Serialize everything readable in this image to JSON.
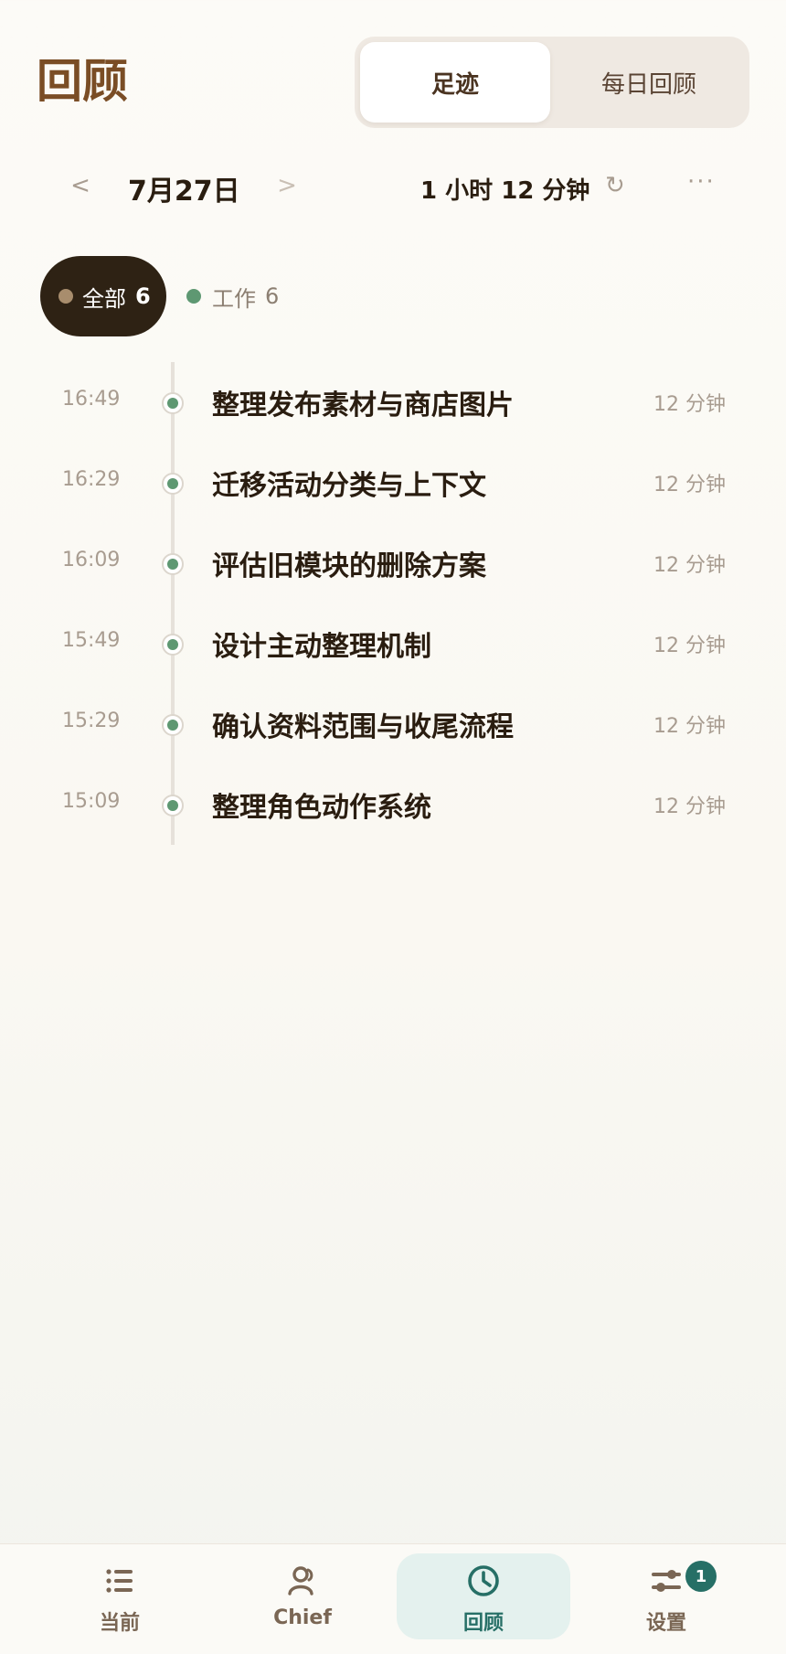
{
  "header": {
    "title": "回顾",
    "segments": [
      {
        "label": "足迹",
        "active": true
      },
      {
        "label": "每日回顾",
        "active": false
      }
    ]
  },
  "date_bar": {
    "prev_label": "<",
    "date": "7月27日",
    "next_label": ">",
    "total_duration": "1 小时 12 分钟",
    "refresh_label": "↻",
    "more_label": "···"
  },
  "filters": {
    "all": {
      "label": "全部",
      "count": "6"
    },
    "work": {
      "label": "工作",
      "count": "6"
    }
  },
  "timeline": [
    {
      "time": "16:49",
      "title": "整理发布素材与商店图片",
      "duration": "12 分钟"
    },
    {
      "time": "16:29",
      "title": "迁移活动分类与上下文",
      "duration": "12 分钟"
    },
    {
      "time": "16:09",
      "title": "评估旧模块的删除方案",
      "duration": "12 分钟"
    },
    {
      "time": "15:49",
      "title": "设计主动整理机制",
      "duration": "12 分钟"
    },
    {
      "time": "15:29",
      "title": "确认资料范围与收尾流程",
      "duration": "12 分钟"
    },
    {
      "time": "15:09",
      "title": "整理角色动作系统",
      "duration": "12 分钟"
    }
  ],
  "bottom_nav": [
    {
      "label": "当前",
      "icon": "list-icon",
      "active": false
    },
    {
      "label": "Chief",
      "icon": "person-icon",
      "active": false
    },
    {
      "label": "回顾",
      "icon": "clock-icon",
      "active": true
    },
    {
      "label": "设置",
      "icon": "sliders-icon",
      "active": false,
      "badge": "1"
    }
  ],
  "colors": {
    "title_brown": "#7a4d25",
    "text_dark": "#2a1d10",
    "muted": "#a89c90",
    "chip_dark": "#2e2214",
    "work_green": "#5e9872",
    "teal": "#266f66",
    "active_nav_bg": "#e4f1ee"
  }
}
